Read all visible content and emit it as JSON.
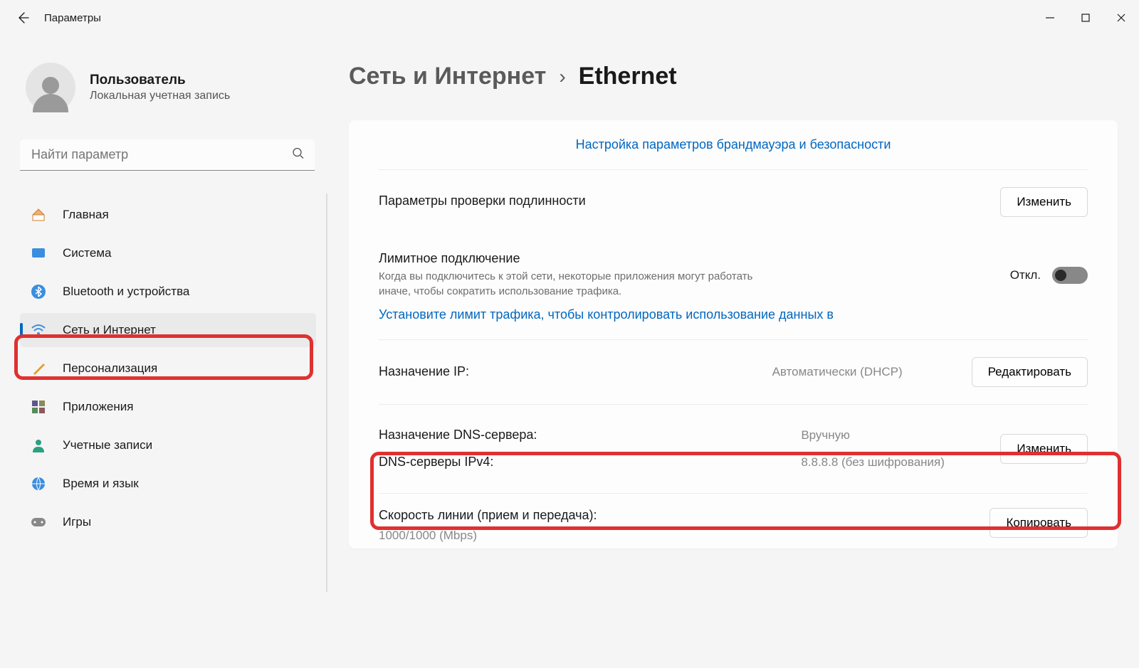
{
  "app": {
    "title": "Параметры"
  },
  "user": {
    "name": "Пользователь",
    "sub": "Локальная учетная запись"
  },
  "search": {
    "placeholder": "Найти параметр"
  },
  "nav": {
    "items": [
      {
        "label": "Главная",
        "icon": "home"
      },
      {
        "label": "Система",
        "icon": "system"
      },
      {
        "label": "Bluetooth и устройства",
        "icon": "bluetooth"
      },
      {
        "label": "Сеть и Интернет",
        "icon": "wifi",
        "active": true
      },
      {
        "label": "Персонализация",
        "icon": "brush"
      },
      {
        "label": "Приложения",
        "icon": "apps"
      },
      {
        "label": "Учетные записи",
        "icon": "person"
      },
      {
        "label": "Время и язык",
        "icon": "time"
      },
      {
        "label": "Игры",
        "icon": "games"
      }
    ]
  },
  "breadcrumb": {
    "parent": "Сеть и Интернет",
    "current": "Ethernet"
  },
  "panel": {
    "firewall_link": "Настройка параметров брандмауэра и безопасности",
    "auth": {
      "title": "Параметры проверки подлинности",
      "button": "Изменить"
    },
    "metered": {
      "title": "Лимитное подключение",
      "desc": "Когда вы подключитесь к этой сети, некоторые приложения могут работать иначе, чтобы сократить использование трафика.",
      "toggle_label": "Откл.",
      "data_limit_link": "Установите лимит трафика, чтобы контролировать использование данных в "
    },
    "ip": {
      "label": "Назначение IP:",
      "value": "Автоматически (DHCP)",
      "button": "Редактировать"
    },
    "dns": {
      "label1": "Назначение DNS-сервера:",
      "label2": "DNS-серверы IPv4:",
      "value1": "Вручную",
      "value2": "8.8.8.8 (без шифрования)",
      "button": "Изменить"
    },
    "speed": {
      "title": "Скорость линии (прием и передача):",
      "value": "1000/1000 (Mbps)",
      "button": "Копировать"
    }
  }
}
